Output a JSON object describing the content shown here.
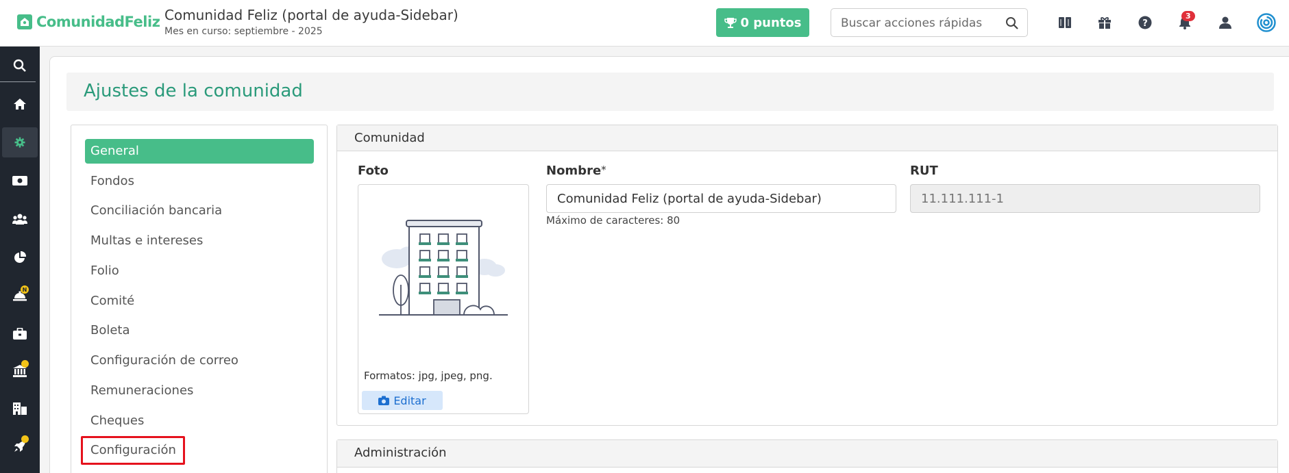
{
  "header": {
    "logo_text": "ComunidadFeliz",
    "title": "Comunidad Feliz (portal de ayuda-Sidebar)",
    "subtitle": "Mes en curso: septiembre - 2025",
    "points_label": "0 puntos",
    "search_placeholder": "Buscar acciones rápidas",
    "notification_count": "3",
    "icons": [
      "book-icon",
      "gift-icon",
      "help-icon",
      "bell-icon",
      "user-icon",
      "fingerprint-icon"
    ]
  },
  "rail": {
    "items": [
      "search-icon",
      "home-icon",
      "gear-icon",
      "money-icon",
      "users-icon",
      "pie-chart-icon",
      "bell-service-icon",
      "briefcase-icon",
      "bank-icon",
      "building-icon",
      "rocket-icon"
    ],
    "active": "gear-icon",
    "badge_letter": "N"
  },
  "page": {
    "title": "Ajustes de la comunidad"
  },
  "settings_nav": {
    "items": [
      {
        "label": "General",
        "active": true
      },
      {
        "label": "Fondos"
      },
      {
        "label": "Conciliación bancaria"
      },
      {
        "label": "Multas e intereses"
      },
      {
        "label": "Folio"
      },
      {
        "label": "Comité"
      },
      {
        "label": "Boleta"
      },
      {
        "label": "Configuración de correo"
      },
      {
        "label": "Remuneraciones"
      },
      {
        "label": "Cheques"
      },
      {
        "label": "Configuración",
        "highlighted": true
      }
    ]
  },
  "comunidad": {
    "header": "Comunidad",
    "photo_label": "Foto",
    "formats": "Formatos: jpg, jpeg, png.",
    "edit_label": "Editar",
    "name_label": "Nombre",
    "name_required_mark": "*",
    "name_value": "Comunidad Feliz (portal de ayuda-Sidebar)",
    "name_hint": "Máximo de caracteres: 80",
    "rut_label": "RUT",
    "rut_placeholder": "11.111.111-1"
  },
  "administracion": {
    "header": "Administración"
  },
  "colors": {
    "brand_green": "#47bd89",
    "title_teal": "#2a9a7a",
    "rail_bg": "#20262f",
    "highlight_red": "#e5121d",
    "edit_blue": "#1d6fd0"
  }
}
